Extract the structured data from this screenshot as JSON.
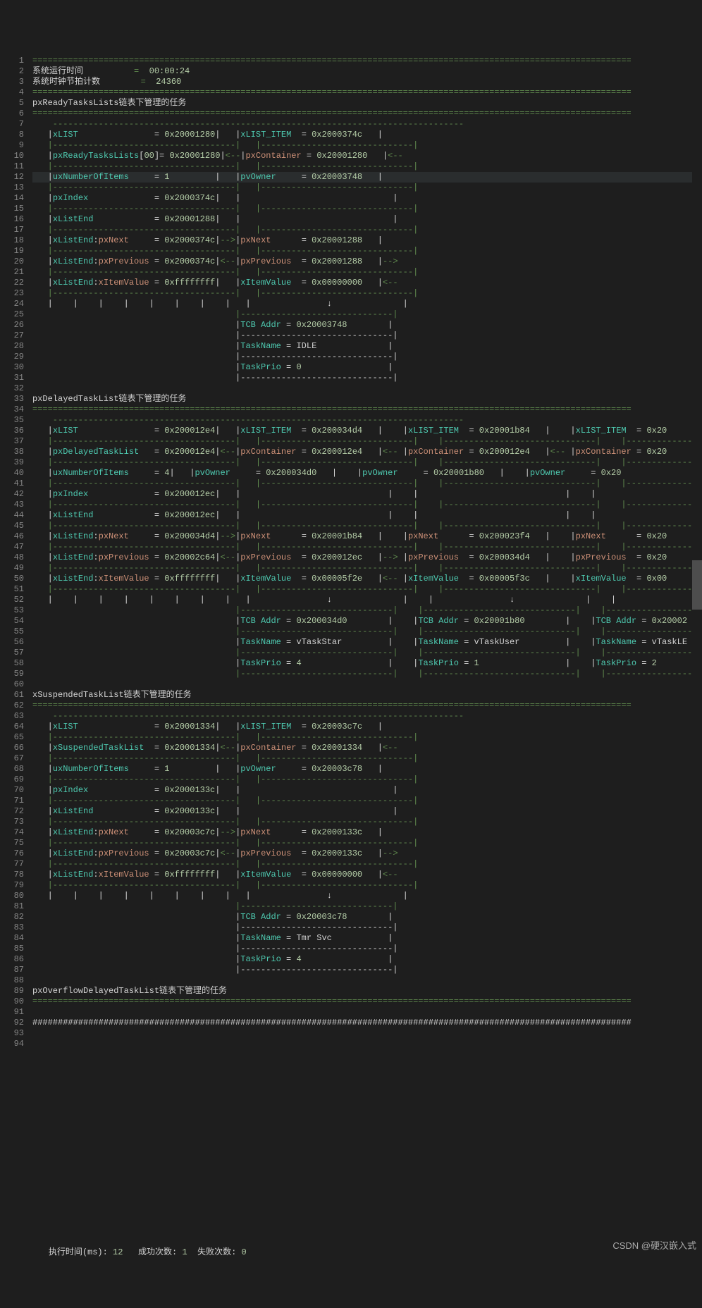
{
  "gutter_start": 1,
  "gutter_end": 94,
  "highlight_line": 12,
  "status": {
    "exec_label": "执行时间(ms):",
    "exec_val": "12",
    "ok_label": "成功次数:",
    "ok_val": "1",
    "fail_label": "失败次数:",
    "fail_val": "0"
  },
  "watermark": "CSDN @硬汉嵌入式",
  "hdr": {
    "eq_top": "======================================================================================================================",
    "runtime_l": "系统运行时间",
    "runtime_v": "00:00:24",
    "ticks_l": "系统时钟节拍计数",
    "ticks_v": "24360",
    "row": "  =  "
  },
  "hash": "######################################################################################################################",
  "dash": {
    "top": "    ---------------------------------------------------------------------------------",
    "one": "   |------------------------------------|   |------------------------------|",
    "wide": "   |------------------------------------|   |------------------------------|    |------------------------------|    |-----------------------------",
    "down_one": "   |    |    |    |    |    |    |    |   |               ↓              |",
    "down_wide": "   |    |    |    |    |    |    |    |   |               ↓              |    |               ↓              |    |               ↓",
    "tcb_top_one": "                                        |------------------------------|",
    "tcb_top_wide": "                                        |------------------------------|    |------------------------------|    |------------------------------"
  },
  "sec": {
    "ready_title": "pxReadyTasksLists链表下管理的任务",
    "delayed_title": "pxDelayedTaskList链表下管理的任务",
    "susp_title": "xSuspendedTaskList链表下管理的任务",
    "overflow_title": "pxOverflowDelayedTaskList链表下管理的任务"
  },
  "ready": {
    "xlist": "0x20001280",
    "xli": "0x2000374c",
    "listname": "pxReadyTasksLists",
    "idx": "00",
    "listaddr": "0x20001280",
    "cont": "0x20001280",
    "nitems": "1",
    "owner": "0x20003748",
    "pxIndex": "0x2000374c",
    "xListEnd": "0x20001288",
    "pxNextL": "0x2000374c",
    "pxNextR": "0x20001288",
    "pxPrevL": "0x2000374c",
    "pxPrevR": "0x20001288",
    "xItemL": "0xffffffff",
    "xItemR": "0x00000000",
    "tcb": "0x20003748",
    "tname": "IDLE",
    "tprio": "0"
  },
  "delayed": {
    "xlist": "0x200012e4",
    "li1": "0x200034d4",
    "li2": "0x20001b84",
    "li3": "0x20",
    "listname": "pxDelayedTaskList",
    "listaddr": "0x200012e4",
    "cont1": "0x200012e4",
    "cont2": "0x200012e4",
    "cont3": "0x20",
    "nitems": "4",
    "owner1": "0x200034d0",
    "owner2": "0x20001b80",
    "owner3": "0x20",
    "pxIndex": "0x200012ec",
    "xListEnd": "0x200012ec",
    "nextL": "0x200034d4",
    "next1": "0x20001b84",
    "next2": "0x200023f4",
    "next3": "0x20",
    "prevL": "0x20002c64",
    "prev1": "0x200012ec",
    "prev2": "0x200034d4",
    "prev3": "0x20",
    "itemL": "0xffffffff",
    "item1": "0x00005f2e",
    "item2": "0x00005f3c",
    "item3": "0x00",
    "tcb1": "0x200034d0",
    "tcb2": "0x20001b80",
    "tcb3": "0x20002",
    "tn1": "vTaskStar",
    "tn2": "vTaskUser",
    "tn3": "vTaskLE",
    "tp1": "4",
    "tp2": "1",
    "tp3": "2"
  },
  "susp": {
    "xlist": "0x20001334",
    "xli": "0x20003c7c",
    "listname": "xSuspendedTaskList",
    "listaddr": "0x20001334",
    "cont": "0x20001334",
    "nitems": "1",
    "owner": "0x20003c78",
    "pxIndex": "0x2000133c",
    "xListEnd": "0x2000133c",
    "pxNextL": "0x20003c7c",
    "pxNextR": "0x2000133c",
    "pxPrevL": "0x20003c7c",
    "pxPrevR": "0x2000133c",
    "xItemL": "0xffffffff",
    "xItemR": "0x00000000",
    "tcb": "0x20003c78",
    "tname": "Tmr Svc",
    "tprio": "4"
  },
  "lbl": {
    "xLIST": "xLIST",
    "xLI": "xLIST_ITEM",
    "pxCont": "pxContainer",
    "uxN": "uxNumberOfItems",
    "pvO": "pvOwner",
    "pxIdx": "pxIndex",
    "xLE": "xListEnd",
    "pxN": "pxNext",
    "pxP": "pxPrevious",
    "xIV": "xItemValue",
    "tcb": "TCB Addr",
    "tn": "TaskName",
    "tp": "TaskPrio",
    "arrR": "-->",
    "arrL": "<--"
  }
}
